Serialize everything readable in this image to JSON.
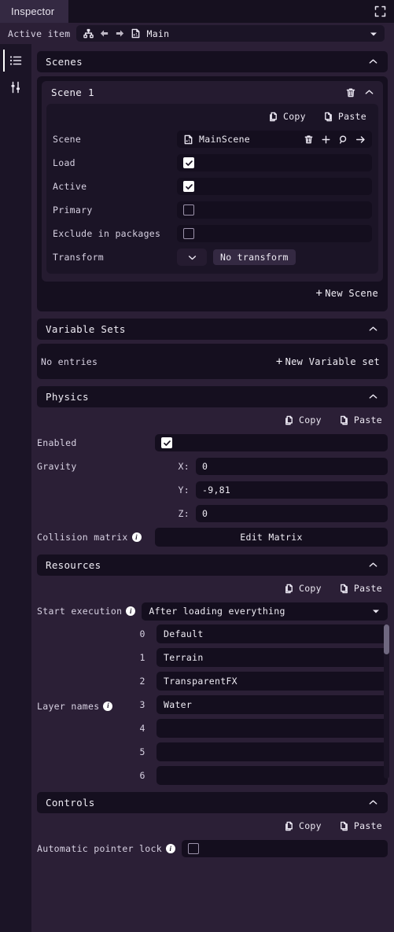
{
  "window": {
    "tab_label": "Inspector",
    "expand_icon": "expand-fullscreen-icon"
  },
  "active_item": {
    "label": "Active item",
    "hierarchy_icon": "hierarchy-icon",
    "back_icon": "arrow-left-icon",
    "forward_icon": "arrow-right-icon",
    "scene_file_icon": "scene-file-icon",
    "value": "Main",
    "chevron_icon": "chevron-down-icon"
  },
  "sidebar": {
    "items": [
      {
        "name": "properties-list",
        "icon": "list-icon",
        "active": true
      },
      {
        "name": "settings-sliders",
        "icon": "sliders-icon",
        "active": false
      }
    ]
  },
  "common": {
    "copy_label": "Copy",
    "paste_label": "Paste",
    "copy_icon": "copy-icon",
    "paste_icon": "paste-icon",
    "collapse_icon": "chevron-up-icon"
  },
  "sections": {
    "scenes": {
      "title": "Scenes",
      "scene_card": {
        "title": "Scene 1",
        "delete_icon": "trash-icon",
        "collapse_icon": "chevron-up-icon",
        "fields": {
          "scene": {
            "label": "Scene",
            "icon": "scene-asset-icon",
            "value": "MainScene",
            "actions": [
              "trash-icon",
              "plus-icon",
              "search-icon",
              "arrow-right-icon"
            ]
          },
          "load": {
            "label": "Load",
            "checked": true
          },
          "active": {
            "label": "Active",
            "checked": true
          },
          "primary": {
            "label": "Primary",
            "checked": false
          },
          "exclude": {
            "label": "Exclude in packages",
            "checked": false
          },
          "transform": {
            "label": "Transform",
            "value": "No transform",
            "chevron": "chevron-down-icon"
          }
        }
      },
      "new_scene_label": "New Scene"
    },
    "variable_sets": {
      "title": "Variable Sets",
      "empty_text": "No entries",
      "new_label": "New Variable set"
    },
    "physics": {
      "title": "Physics",
      "enabled": {
        "label": "Enabled",
        "checked": true
      },
      "gravity": {
        "label": "Gravity",
        "axes": [
          {
            "tag": "X:",
            "value": "0"
          },
          {
            "tag": "Y:",
            "value": "-9,81"
          },
          {
            "tag": "Z:",
            "value": "0"
          }
        ]
      },
      "collision_matrix": {
        "label": "Collision matrix",
        "button": "Edit Matrix",
        "info": "i"
      }
    },
    "resources": {
      "title": "Resources",
      "start_execution": {
        "label": "Start execution",
        "info": "i",
        "value": "After loading everything",
        "chevron": "chevron-down-icon"
      },
      "layer_names": {
        "label": "Layer names",
        "info": "i",
        "items": [
          {
            "index": "0",
            "value": "Default"
          },
          {
            "index": "1",
            "value": "Terrain"
          },
          {
            "index": "2",
            "value": "TransparentFX"
          },
          {
            "index": "3",
            "value": "Water"
          },
          {
            "index": "4",
            "value": ""
          },
          {
            "index": "5",
            "value": ""
          },
          {
            "index": "6",
            "value": ""
          }
        ]
      }
    },
    "controls": {
      "title": "Controls",
      "automatic_pointer_lock": {
        "label": "Automatic pointer lock",
        "info": "i",
        "checked": false
      }
    }
  },
  "colors": {
    "panel_bg": "#2b1f36",
    "header_bg": "#16101f",
    "card_bg": "#150f1f",
    "field_bg": "#140e1e",
    "tab_bg": "#342942",
    "text": "#efecf4",
    "muted_text": "#d8d2e3"
  }
}
